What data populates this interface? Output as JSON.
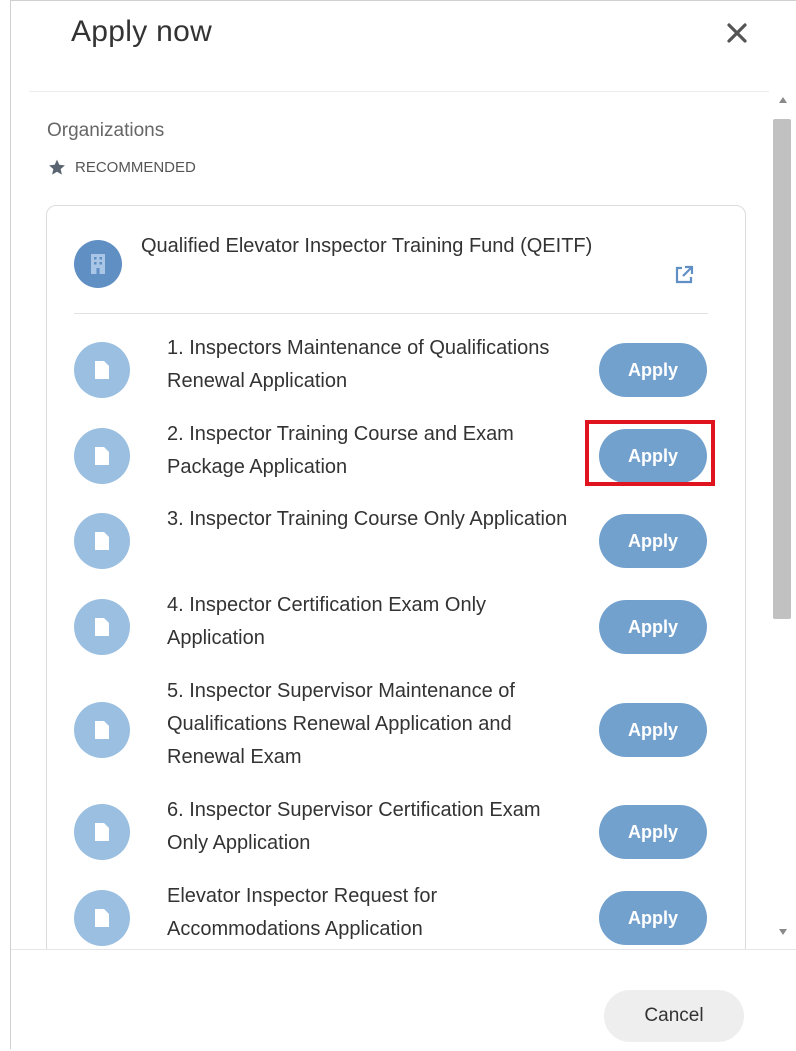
{
  "dialog": {
    "title": "Apply now",
    "close_icon": "close-icon"
  },
  "section": {
    "label": "Organizations",
    "recommended_label": "RECOMMENDED",
    "recommended_icon": "star-icon"
  },
  "organization": {
    "name": "Qualified Elevator Inspector Training Fund (QEITF)",
    "avatar_icon": "building-icon",
    "link_icon": "external-link-icon"
  },
  "applications": [
    {
      "label": "1. Inspectors Maintenance of Qualifications Renewal Application",
      "button": "Apply"
    },
    {
      "label": "2. Inspector Training Course and Exam Package Application",
      "button": "Apply"
    },
    {
      "label": "3. Inspector Training Course Only Application",
      "button": "Apply"
    },
    {
      "label": "4. Inspector Certification Exam Only Application",
      "button": "Apply"
    },
    {
      "label": "5. Inspector Supervisor Maintenance of Qualifications Renewal Application and Renewal Exam",
      "button": "Apply"
    },
    {
      "label": "6. Inspector Supervisor Certification Exam Only Application",
      "button": "Apply"
    },
    {
      "label": "Elevator Inspector Request for Accommodations Application",
      "button": "Apply"
    }
  ],
  "footer": {
    "cancel_label": "Cancel"
  },
  "colors": {
    "accent": "#73a1ce",
    "avatar": "#5f8fc3",
    "doc_icon_bg": "#9bbfe0",
    "highlight": "#e0141e"
  }
}
